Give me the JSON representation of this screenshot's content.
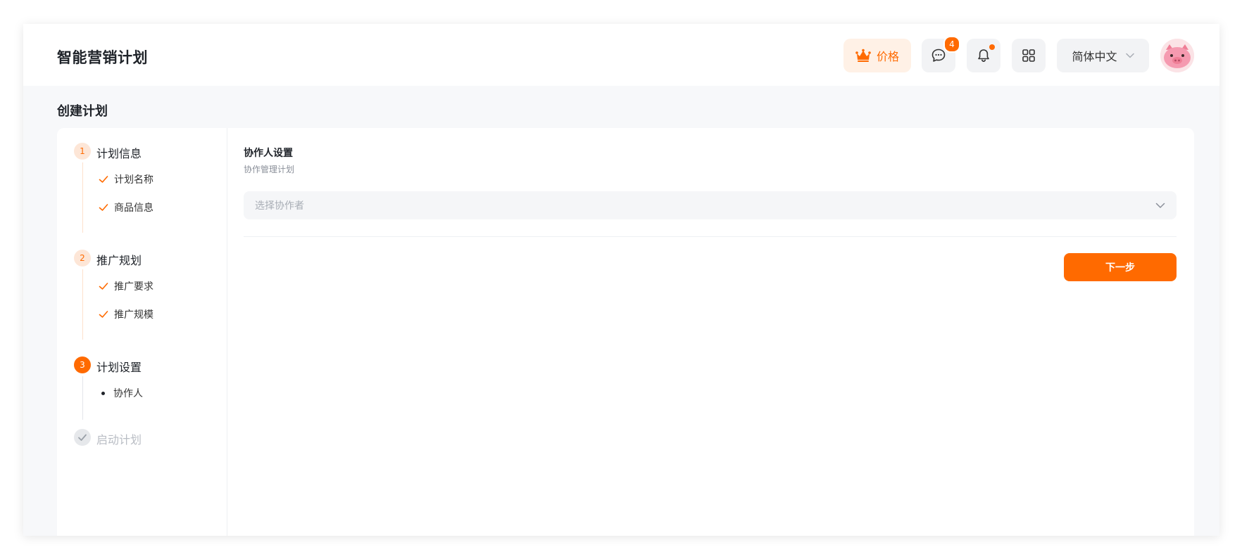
{
  "header": {
    "title": "智能营销计划",
    "price_label": "价格",
    "message_badge": "4",
    "language": "简体中文"
  },
  "page": {
    "title": "创建计划"
  },
  "steps": [
    {
      "number": "1",
      "title": "计划信息",
      "state": "completed",
      "subs": [
        "计划名称",
        "商品信息"
      ]
    },
    {
      "number": "2",
      "title": "推广规划",
      "state": "completed",
      "subs": [
        "推广要求",
        "推广规模"
      ]
    },
    {
      "number": "3",
      "title": "计划设置",
      "state": "active",
      "subs": [
        "协作人"
      ]
    },
    {
      "number": "",
      "title": "启动计划",
      "state": "pending",
      "subs": []
    }
  ],
  "content": {
    "section_title": "协作人设置",
    "section_subtitle": "协作管理计划",
    "select_placeholder": "选择协作者",
    "next_label": "下一步"
  },
  "colors": {
    "accent": "#ff6a00",
    "accent_light": "#fff1e6",
    "background": "#f7f8fa"
  },
  "icons": {
    "price": "crown-icon",
    "messages": "chat-bubble-icon",
    "notifications": "bell-icon",
    "apps": "grid-icon",
    "language": "chevron-down-icon",
    "select": "chevron-down-icon",
    "step_done": "check-icon"
  }
}
